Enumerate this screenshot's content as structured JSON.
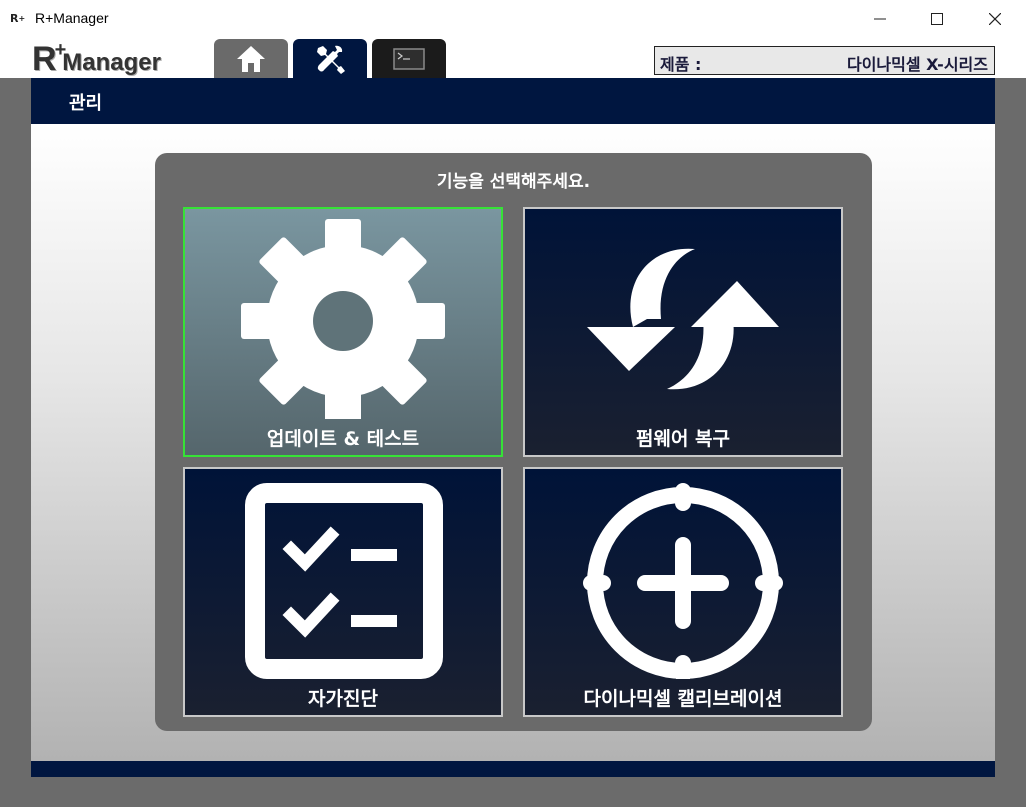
{
  "window": {
    "title": "R+Manager",
    "icon_name": "app-logo-icon",
    "controls": {
      "minimize": "minimize-icon",
      "maximize": "maximize-icon",
      "close": "close-icon"
    }
  },
  "header": {
    "logo": {
      "r": "R",
      "plus": "+",
      "text": "Manager"
    },
    "tabs": [
      {
        "name": "home",
        "icon": "home-icon",
        "active": false
      },
      {
        "name": "tools",
        "icon": "tools-icon",
        "active": true
      },
      {
        "name": "console",
        "icon": "console-icon",
        "active": false
      }
    ],
    "product": {
      "label": "제품 :",
      "value": "다이나믹셀 X-시리즈"
    }
  },
  "section": {
    "title": "관리"
  },
  "panel": {
    "prompt": "기능을 선택해주세요.",
    "cards": [
      {
        "label": "업데이트 & 테스트",
        "icon": "gear-icon",
        "selected": true
      },
      {
        "label": "펌웨어 복구",
        "icon": "refresh-icon",
        "selected": false
      },
      {
        "label": "자가진단",
        "icon": "checklist-icon",
        "selected": false
      },
      {
        "label": "다이나믹셀 캘리브레이션",
        "icon": "crosshair-icon",
        "selected": false
      }
    ]
  },
  "colors": {
    "navy": "#001640",
    "selected_border": "#36e236",
    "panel_bg": "#6a6a6a"
  }
}
